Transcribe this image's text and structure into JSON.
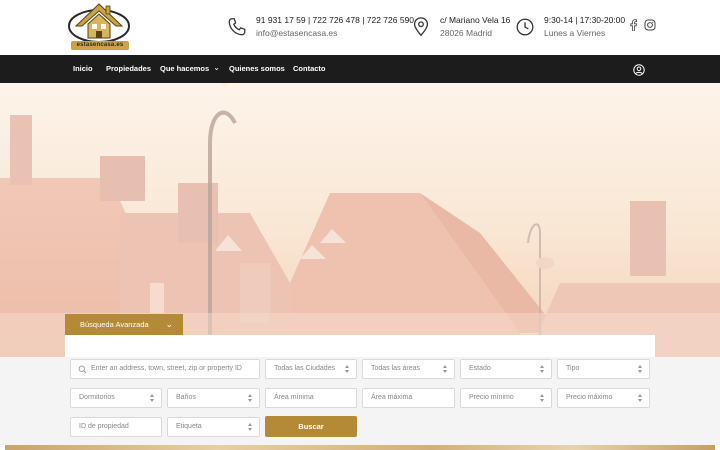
{
  "header": {
    "logo_text": "estasencasa.es",
    "phone": {
      "line1": "91 931 17 59 | 722 726 478 | 722 726 590",
      "line2": "info@estasencasa.es",
      "icon": "phone-icon"
    },
    "address": {
      "line1": "c/ Mariano Vela 16",
      "line2": "28026 Madrid",
      "icon": "map-pin-icon"
    },
    "hours": {
      "line1": "9:30-14 | 17:30-20:00",
      "line2": "Lunes a Viernes",
      "icon": "clock-icon"
    },
    "social": [
      "facebook-icon",
      "instagram-icon"
    ]
  },
  "nav": {
    "items": [
      {
        "label": "Inicio"
      },
      {
        "label": "Propiedades"
      },
      {
        "label": "Que hacemos",
        "dropdown": true
      },
      {
        "label": "Quienes somos"
      },
      {
        "label": "Contacto"
      }
    ],
    "user_icon": "user-circle-icon"
  },
  "search": {
    "tab_label": "Búsqueda Avanzada",
    "keyword_placeholder": "Enter an address, town, street, zip or property ID",
    "ciudades": "Todas las Ciudades",
    "areas": "Todas las áreas",
    "estado": "Estado",
    "tipo": "Tipo",
    "dormitorios": "Dormitorios",
    "banos": "Baños",
    "area_min": "Área mínima",
    "area_max": "Área máxima",
    "precio_min": "Precio mínimo",
    "precio_max": "Precio máximo",
    "property_id": "ID de propiedad",
    "etiqueta": "Etiqueta",
    "button": "Buscar"
  },
  "colors": {
    "accent": "#b58a36",
    "nav_bg": "#1c1c1c"
  }
}
